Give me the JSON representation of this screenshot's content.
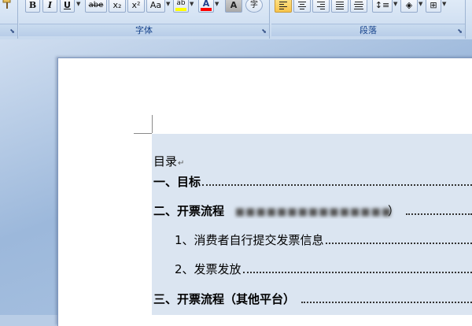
{
  "ribbon": {
    "font_group": {
      "label": "字体",
      "buttons": {
        "bold": "B",
        "italic": "I",
        "underline": "U",
        "strikethrough": "abe",
        "subscript": "x₂",
        "superscript": "x²",
        "change_case": "Aa",
        "highlight": "ab",
        "font_color": "A",
        "char_shading": "A",
        "enclose": "字"
      }
    },
    "paragraph_group": {
      "label": "段落"
    }
  },
  "document": {
    "toc_title": "目录",
    "paragraph_mark": "↵",
    "entries": [
      {
        "text": "一、目标",
        "level": 1
      },
      {
        "text_before": "二、开票流程",
        "text_after": "）",
        "level": 1
      },
      {
        "text": "1、消费者自行提交发票信息",
        "level": 2
      },
      {
        "text": "2、发票发放",
        "level": 2
      },
      {
        "text": "三、开票流程（其他平台）",
        "level": 1
      }
    ]
  },
  "colors": {
    "ribbon_bg": "#dfeaf7",
    "group_label": "#15428b",
    "active_button": "#f8c44b",
    "toc_field_shading": "#dbe5f1",
    "highlight_yellow": "#ffff00",
    "font_color_red": "#ff0000"
  }
}
